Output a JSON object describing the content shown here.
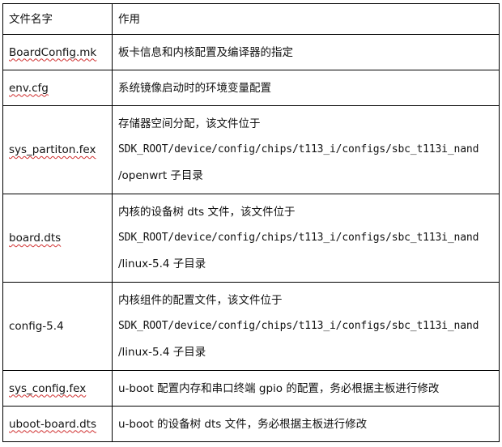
{
  "table": {
    "headers": [
      "文件名字",
      "作用"
    ],
    "rows": [
      {
        "file": "BoardConfig.mk",
        "lines": [
          {
            "text": "板卡信息和内核配置及编译器的指定",
            "mono": false
          }
        ]
      },
      {
        "file": "env.cfg",
        "lines": [
          {
            "text": "系统镜像启动时的环境变量配置",
            "mono": false
          }
        ]
      },
      {
        "file": "sys_partiton.fex",
        "lines": [
          {
            "text": "存储器空间分配，该文件位于",
            "mono": false
          },
          {
            "text": "SDK_ROOT/device/config/chips/t113_i/configs/sbc_t113i_nand",
            "mono": true
          },
          {
            "text": "/openwrt 子目录",
            "mono": false
          }
        ]
      },
      {
        "file": "board.dts",
        "lines": [
          {
            "text": "内核的设备树 dts 文件，该文件位于",
            "mono": false
          },
          {
            "text": "SDK_ROOT/device/config/chips/t113_i/configs/sbc_t113i_nand",
            "mono": true
          },
          {
            "text": "/linux-5.4 子目录",
            "mono": false
          }
        ]
      },
      {
        "file": "config-5.4",
        "lines": [
          {
            "text": "内核组件的配置文件，该文件位于",
            "mono": false
          },
          {
            "text": "SDK_ROOT/device/config/chips/t113_i/configs/sbc_t113i_nand",
            "mono": true
          },
          {
            "text": "/linux-5.4 子目录",
            "mono": false
          }
        ]
      },
      {
        "file": "sys_config.fex",
        "lines": [
          {
            "text": "u-boot 配置内存和串口终端 gpio 的配置，务必根据主板进行修改",
            "mono": false
          }
        ]
      },
      {
        "file": "uboot-board.dts",
        "lines": [
          {
            "text": "u-boot 的设备树 dts 文件，务必根据主板进行修改",
            "mono": false
          }
        ]
      }
    ]
  },
  "colors": {
    "border": "#000000",
    "spell_underline": "#d03030"
  }
}
